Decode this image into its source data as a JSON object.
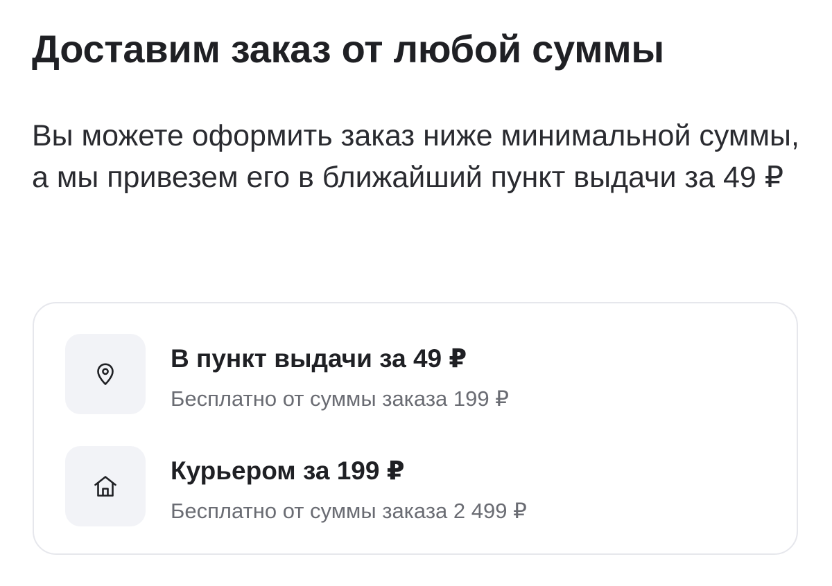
{
  "sheet": {
    "title": "Доставим заказ от любой суммы",
    "description": "Вы можете оформить заказ ниже минимальной суммы, а мы привезем его в ближайший пункт выдачи за 49 ₽"
  },
  "options": [
    {
      "icon": "location-pin-icon",
      "title": "В пункт выдачи за 49 ₽",
      "subtitle": "Бесплатно от суммы заказа 199 ₽"
    },
    {
      "icon": "home-icon",
      "title": "Курьером за 199 ₽",
      "subtitle": "Бесплатно от суммы заказа 2 499 ₽"
    }
  ],
  "colors": {
    "text_primary": "#1f2024",
    "text_secondary": "#6a6c73",
    "icon_bg": "#f2f3f7",
    "card_border": "#e6e7ec"
  }
}
